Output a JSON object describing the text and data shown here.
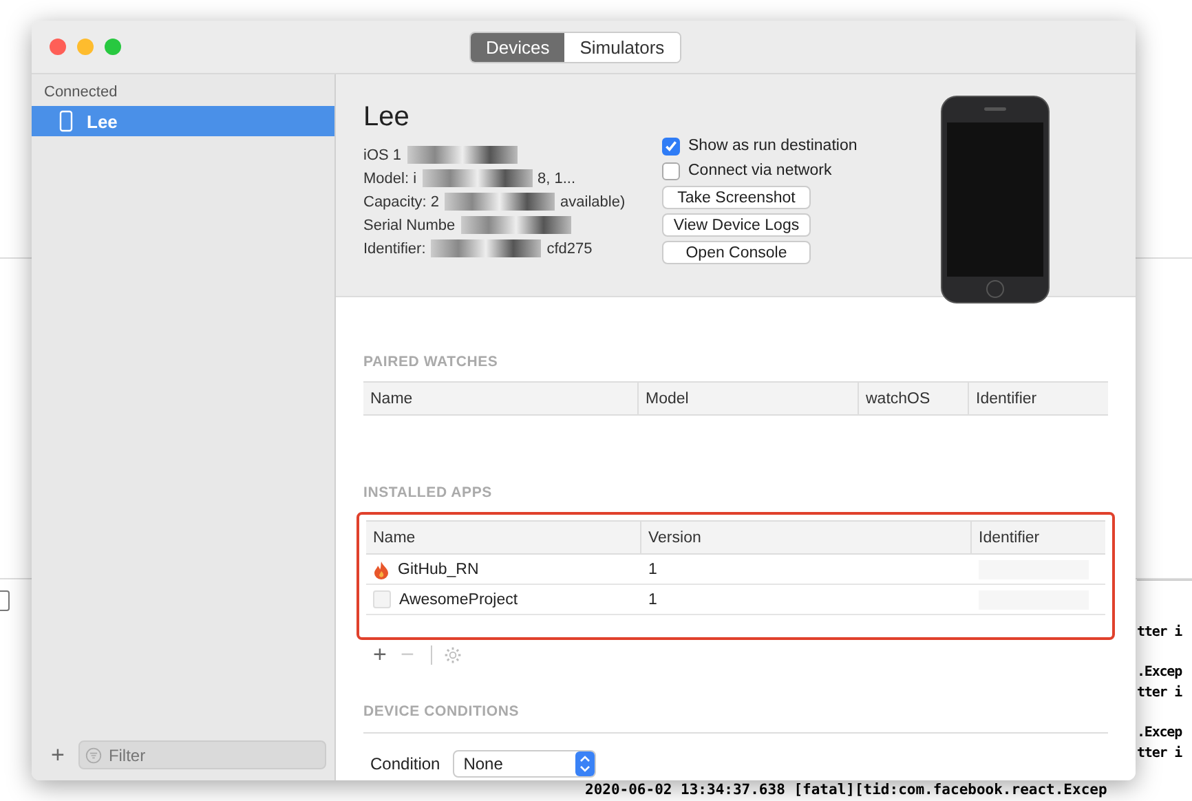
{
  "window": {
    "tabs": [
      {
        "label": "Devices",
        "selected": true
      },
      {
        "label": "Simulators",
        "selected": false
      }
    ]
  },
  "sidebar": {
    "section": "Connected",
    "items": [
      {
        "label": "Lee",
        "selected": true
      }
    ],
    "add": "+",
    "filter": {
      "placeholder": "Filter"
    }
  },
  "device": {
    "name": "Lee",
    "info": [
      {
        "left": "iOS 1"
      },
      {
        "left": "Model: i",
        "right": "8, 1..."
      },
      {
        "left": "Capacity: 2",
        "right": "available)"
      },
      {
        "left": "Serial Numbe"
      },
      {
        "left": "Identifier:",
        "right": "cfd275"
      }
    ],
    "options": [
      {
        "label": "Show as run destination",
        "checked": true
      },
      {
        "label": "Connect via network",
        "checked": false
      }
    ],
    "buttons": [
      "Take Screenshot",
      "View Device Logs",
      "Open Console"
    ]
  },
  "paired_watches": {
    "heading": "PAIRED WATCHES",
    "columns": [
      "Name",
      "Model",
      "watchOS",
      "Identifier"
    ]
  },
  "installed_apps": {
    "heading": "INSTALLED APPS",
    "highlighted": true,
    "columns": [
      "Name",
      "Version",
      "Identifier"
    ],
    "rows": [
      {
        "kind": "flame",
        "name": "GitHub_RN",
        "version": "1"
      },
      {
        "kind": "blank",
        "name": "AwesomeProject",
        "version": "1"
      }
    ],
    "toolbar": [
      "+",
      "−"
    ]
  },
  "device_conditions": {
    "heading": "DEVICE CONDITIONS",
    "label": "Condition",
    "value": "None"
  },
  "console": {
    "groups": [
      [
        "tter i"
      ],
      [
        ".Excep",
        "tter i"
      ],
      [
        ".Excep",
        "tter i"
      ]
    ],
    "bottom_line": "2020-06-02 13:34:37.638 [fatal][tid:com.facebook.react.Excep"
  }
}
